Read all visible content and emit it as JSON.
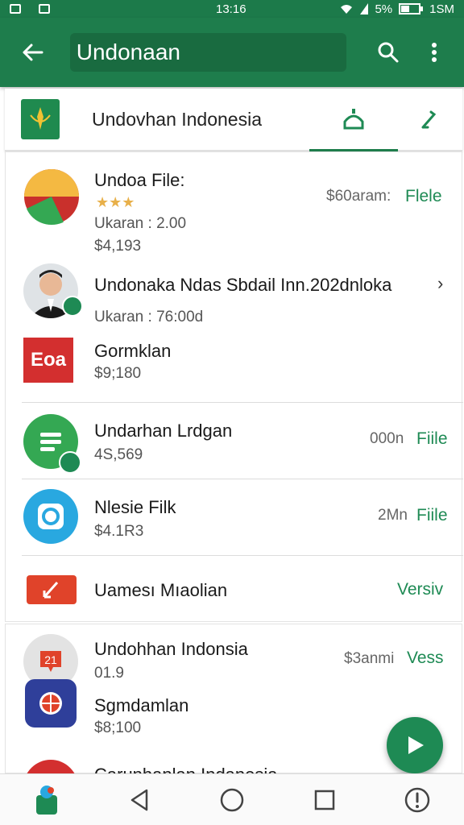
{
  "status_bar": {
    "time": "13:16",
    "battery": "5%",
    "right_text": "1SM"
  },
  "search": {
    "query": "Undonaan"
  },
  "header": {
    "title": "Undovhan Indonesia"
  },
  "items": [
    {
      "title": "Undoa File:",
      "sub1": "Ukaran : 2.00",
      "sub2": "$4,193",
      "meta": "$60aram:",
      "action": "Flele"
    },
    {
      "title": "Undonaka Ndas Sbdail Inn.202dnloka",
      "sub1": "Ukaran : 76:00d",
      "chevron": "›"
    },
    {
      "title": "Gormklan",
      "sub1": "$9;180",
      "logo_text": "Eoa"
    },
    {
      "title": "Undarhan Lrdgan",
      "sub1": "4S,569",
      "meta": "000n",
      "action": "Fiile"
    },
    {
      "title": "Nlesie Filk",
      "sub1": "$4.1R3",
      "meta": "2Mn",
      "action": "Fiile"
    },
    {
      "title": "Uamesı Mıaolian",
      "action": "Versiv"
    },
    {
      "title": "Undohhan Indonsia",
      "sub1": "01.9",
      "meta": "$3anmi",
      "action": "Vess"
    },
    {
      "title": "Sgmdamlan",
      "sub1": "$8;100"
    },
    {
      "title": "Carunhanlan Indanesia"
    }
  ],
  "colors": {
    "primary": "#1e7d4c",
    "accent": "#1e8a54"
  },
  "icons": [
    "back-arrow-icon",
    "search-icon",
    "more-vert-icon",
    "back-triangle-icon",
    "home-circle-icon",
    "recents-square-icon"
  ]
}
